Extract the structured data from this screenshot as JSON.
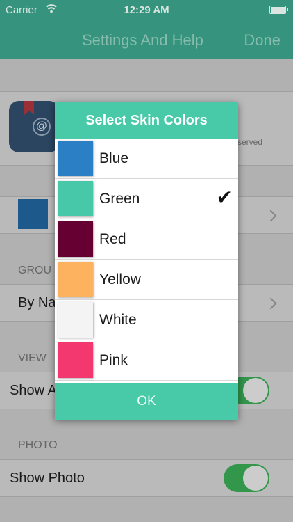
{
  "status_bar": {
    "carrier": "Carrier",
    "time": "12:29 AM"
  },
  "nav": {
    "title": "Settings And Help",
    "done": "Done"
  },
  "background": {
    "app_info_fragment": "served",
    "group_header": "GROU",
    "group_row": "By Na",
    "view_header": "VIEW",
    "view_row": "Show A",
    "photo_header": "PHOTO",
    "photo_row": "Show Photo"
  },
  "dialog": {
    "title": "Select Skin Colors",
    "options": [
      {
        "label": "Blue",
        "color": "#2b80c5",
        "selected": false
      },
      {
        "label": "Green",
        "color": "#47c9a9",
        "selected": true
      },
      {
        "label": "Red",
        "color": "#660033",
        "selected": false
      },
      {
        "label": "Yellow",
        "color": "#fdb25f",
        "selected": false
      },
      {
        "label": "White",
        "color": "#f4f4f4",
        "selected": false
      },
      {
        "label": "Pink",
        "color": "#f2386f",
        "selected": false
      }
    ],
    "ok_label": "OK"
  }
}
